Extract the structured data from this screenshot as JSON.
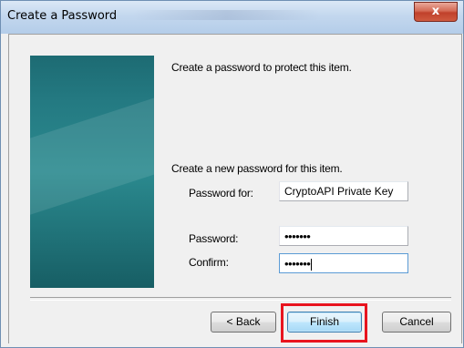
{
  "window": {
    "title": "Create a Password",
    "close_glyph": "x"
  },
  "intro_text": "Create a password to protect this item.",
  "section_text": "Create a new password for this item.",
  "fields": {
    "password_for_label": "Password for:",
    "password_for_value": "CryptoAPI Private Key",
    "password_label": "Password:",
    "password_value": "•••••••",
    "confirm_label": "Confirm:",
    "confirm_value": "•••••••"
  },
  "buttons": {
    "back": "< Back",
    "finish": "Finish",
    "cancel": "Cancel"
  },
  "colors": {
    "highlight": "#e8141e",
    "side_panel": "#247a82"
  }
}
